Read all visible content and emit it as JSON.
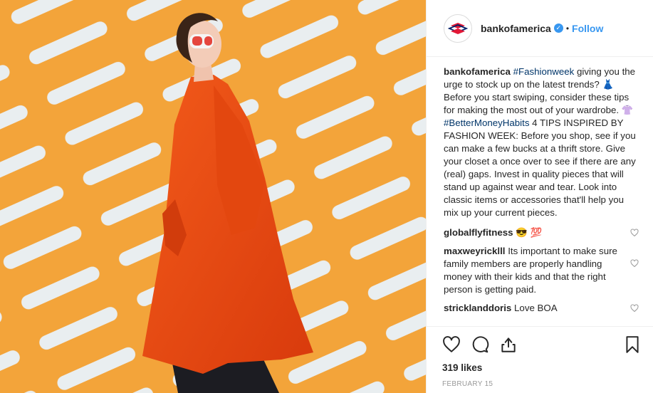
{
  "post": {
    "account": "bankofamerica",
    "follow_label": "Follow",
    "dot": "•",
    "verified_mark": "✓",
    "caption_user": "bankofamerica",
    "caption_parts": {
      "tag1": "#Fashionweek",
      "text1": " giving you the urge to stock up on the latest trends? ",
      "emoji1": "👗",
      "text2": " Before you start swiping, consider these tips for making the most out of your wardrobe. ",
      "emoji2": "👚",
      "tag2": "#BetterMoneyHabits",
      "text3": " 4 TIPS INSPIRED BY FASHION WEEK: Before you shop, see if you can make a few bucks at a thrift store. Give your closet a once over to see if there are any (real) gaps. Invest in quality pieces that will stand up against wear and tear. Look into classic items or accessories that'll help you mix up your current pieces."
    },
    "comments": [
      {
        "user": "globalflyfitness",
        "text": " 😎 💯"
      },
      {
        "user": "maxweyricklll",
        "text": " Its important to make sure family members are properly handling money with their kids and that the right person is getting paid."
      },
      {
        "user": "stricklanddoris",
        "text": " Love BOA"
      }
    ],
    "likes": "319 likes",
    "date": "FEBRUARY 15"
  },
  "icons": [
    "bank-of-america-logo-icon",
    "verified-badge-icon",
    "heart-icon",
    "comment-icon",
    "share-icon",
    "bookmark-icon"
  ],
  "colors": {
    "accent": "#3897f0",
    "hashtag": "#003569",
    "background_orange": "#f3a43a",
    "coat_orange": "#ee4a12"
  }
}
